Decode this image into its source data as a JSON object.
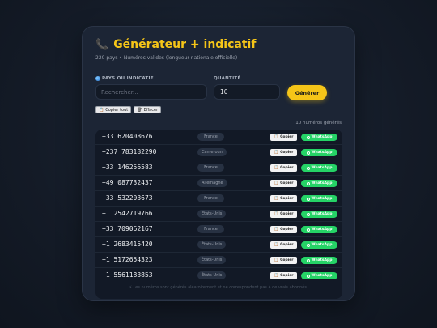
{
  "header": {
    "title": "Générateur + indicatif",
    "subtitle": "220 pays • Numéros valides (longueur nationale officielle)"
  },
  "form": {
    "country_label": "PAYS OU INDICATIF",
    "search_placeholder": "Rechercher...",
    "quantity_label": "QUANTITÉ",
    "quantity_value": "10",
    "generate_label": "Générer"
  },
  "toolbar": {
    "copy_all_label": "Copier tout",
    "clear_label": "Effacer"
  },
  "results": {
    "count_text": "10 numéros générés",
    "copy_label": "Copier",
    "whatsapp_label": "WhatsApp",
    "rows": [
      {
        "number": "+33 620408676",
        "country": "France"
      },
      {
        "number": "+237 783182290",
        "country": "Cameroun"
      },
      {
        "number": "+33 146256583",
        "country": "France"
      },
      {
        "number": "+49 087732437",
        "country": "Allemagne"
      },
      {
        "number": "+33 532203673",
        "country": "France"
      },
      {
        "number": "+1 2542719766",
        "country": "États-Unis"
      },
      {
        "number": "+33 709062167",
        "country": "France"
      },
      {
        "number": "+1 2683415420",
        "country": "États-Unis"
      },
      {
        "number": "+1 5172654323",
        "country": "États-Unis"
      },
      {
        "number": "+1 5561183853",
        "country": "États-Unis"
      }
    ]
  },
  "footer": {
    "note": "Les numéros sont générés aléatoirement et ne correspondent pas à de vrais abonnés."
  },
  "colors": {
    "accent": "#f5c518",
    "whatsapp": "#25d366",
    "card_bg": "#1c2535"
  }
}
